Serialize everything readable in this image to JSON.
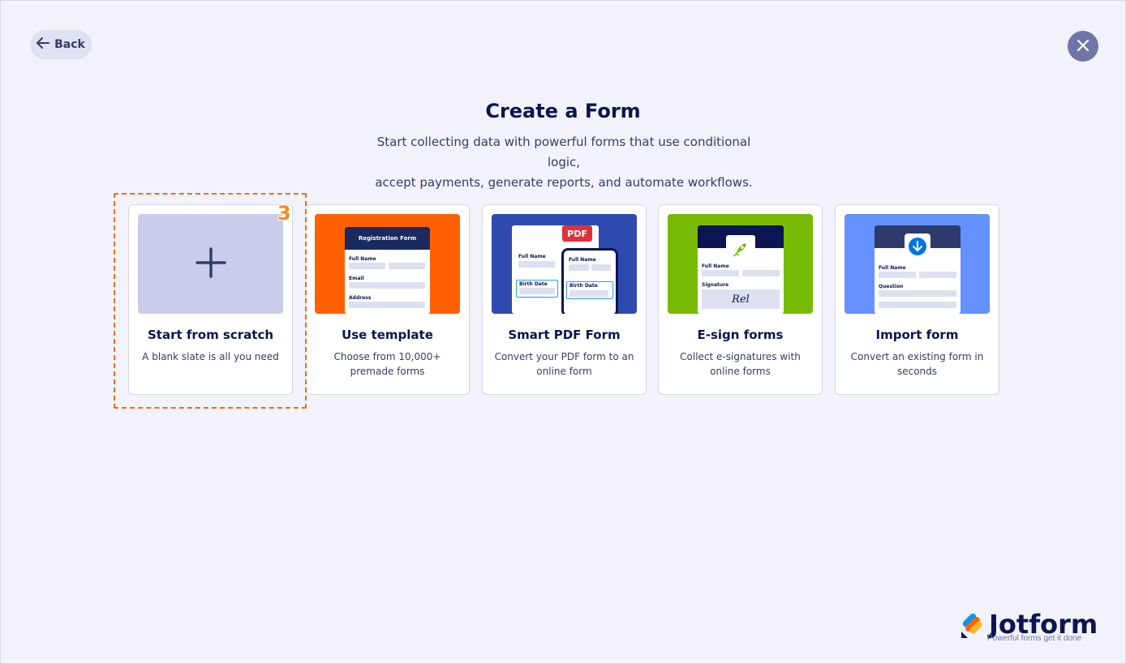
{
  "nav": {
    "back_label": "Back",
    "back_icon": "arrow-left-icon",
    "close_icon": "close-icon"
  },
  "header": {
    "title": "Create a Form",
    "subtitle_line1": "Start collecting data with powerful forms that use conditional logic,",
    "subtitle_line2": "accept payments, generate reports, and automate workflows."
  },
  "options": [
    {
      "title": "Start from scratch",
      "desc": "A blank slate is all you need",
      "icon": "plus-icon",
      "thumb_color": "#c9cdeb"
    },
    {
      "title": "Use template",
      "desc": "Choose from 10,000+ premade forms",
      "thumb_color": "#ff6100",
      "preview": {
        "header": "Registration Form",
        "field1": "Full Name",
        "field2": "Email",
        "field3": "Address"
      }
    },
    {
      "title": "Smart PDF Form",
      "desc": "Convert your PDF form to an online form",
      "thumb_color": "#2e4ab0",
      "preview": {
        "badge": "PDF",
        "field1": "Full Name",
        "field2": "Birth Date",
        "phone_field1": "Full Name",
        "phone_field2": "Birth Date"
      }
    },
    {
      "title": "E-sign forms",
      "desc": "Collect e-signatures with online forms",
      "thumb_color": "#78bb07",
      "preview": {
        "field1": "Full Name",
        "field2": "Signature",
        "signature": "Rel",
        "icon": "pen-nib-icon"
      }
    },
    {
      "title": "Import form",
      "desc": "Convert an existing form in seconds",
      "thumb_color": "#6391ff",
      "preview": {
        "field1": "Full Name",
        "field2": "Question",
        "icon": "download-arrow-icon"
      }
    }
  ],
  "annotation": {
    "step": "3",
    "color": "#f26b1d"
  },
  "brand": {
    "name": "Jotform",
    "tagline": "Powerful forms get it done",
    "icon": "jotform-logo-icon"
  }
}
